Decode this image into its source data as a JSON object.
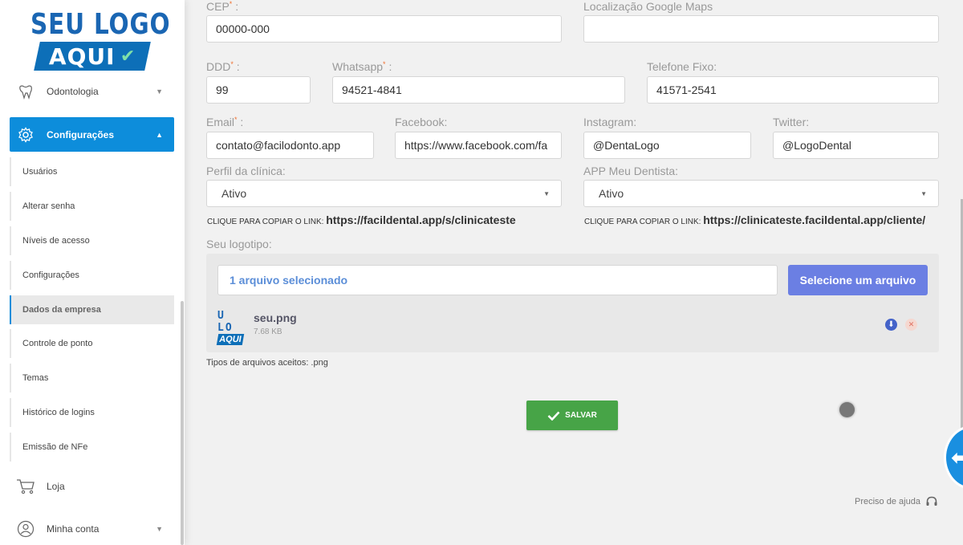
{
  "logo": {
    "line1": "SEU LOGO",
    "line2": "AQUI"
  },
  "sidebar": {
    "odontologia": "Odontologia",
    "configuracoes": "Configurações",
    "submenu": [
      "Usuários",
      "Alterar senha",
      "Níveis de acesso",
      "Configurações",
      "Dados da empresa",
      "Controle de ponto",
      "Temas",
      "Histórico de logins",
      "Emissão de NFe"
    ],
    "selected_submenu": "Dados da empresa",
    "loja": "Loja",
    "minha_conta": "Minha conta"
  },
  "form": {
    "cep_label": "CEP",
    "cep_value": "00000-000",
    "maps_label": "Localização Google Maps",
    "maps_value": "",
    "ddd_label": "DDD",
    "ddd_value": "99",
    "whatsapp_label": "Whatsapp",
    "whatsapp_value": "94521-4841",
    "telefone_label": "Telefone Fixo:",
    "telefone_value": "41571-2541",
    "email_label": "Email",
    "email_value": "contato@facilodonto.app",
    "facebook_label": "Facebook:",
    "facebook_value": "https://www.facebook.com/fa",
    "instagram_label": "Instagram:",
    "instagram_value": "@DentaLogo",
    "twitter_label": "Twitter:",
    "twitter_value": "@LogoDental",
    "perfil_label": "Perfil da clínica:",
    "perfil_value": "Ativo",
    "app_label": "APP Meu Dentista:",
    "app_value": "Ativo",
    "copy_prefix": "CLIQUE PARA COPIAR O LINK:",
    "perfil_link": "https://facildental.app/s/clinicateste",
    "app_link": "https://clinicateste.facildental.app/cliente/",
    "logo_label": "Seu logotipo:"
  },
  "upload": {
    "selected_text": "1 arquivo selecionado",
    "button_label": "Selecione um arquivo",
    "file_name": "seu.png",
    "file_size": "7.68 KB",
    "thumb_top": "U LO",
    "thumb_bottom": "AQUI",
    "accepted": "Tipos de arquivos aceitos: .png"
  },
  "actions": {
    "save": "SALVAR",
    "help": "Preciso de ajuda"
  },
  "colors": {
    "primary": "#0d8ddb",
    "save": "#47a447",
    "upload_button": "#6b7fe3",
    "required": "#f07030"
  }
}
